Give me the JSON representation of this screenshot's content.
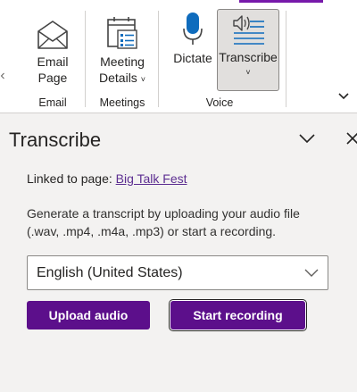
{
  "ribbon": {
    "groups": [
      {
        "label": "Email",
        "buttons": [
          {
            "label_line1": "Email",
            "label_line2": "Page",
            "icon": "envelope-icon"
          }
        ]
      },
      {
        "label": "Meetings",
        "buttons": [
          {
            "label_line1": "Meeting",
            "label_line2": "Details",
            "icon": "calendar-icon",
            "dropdown": "˅"
          }
        ]
      },
      {
        "label": "Voice",
        "buttons": [
          {
            "label_line1": "Dictate",
            "icon": "microphone-icon"
          },
          {
            "label_line1": "Transcribe",
            "icon": "transcribe-icon",
            "dropdown": "˅",
            "selected": true
          }
        ]
      }
    ],
    "accent_color": "#7719aa"
  },
  "pane": {
    "title": "Transcribe",
    "linked_prefix": "Linked to page: ",
    "linked_page": "Big Talk Fest",
    "description": "Generate a transcript by uploading your audio file (.wav, .mp4, .m4a, .mp3) or start a recording.",
    "language": {
      "selected": "English (United States)"
    },
    "upload_label": "Upload audio",
    "record_label": "Start recording",
    "button_color": "#5c0f8b",
    "link_color": "#5c2e91"
  }
}
